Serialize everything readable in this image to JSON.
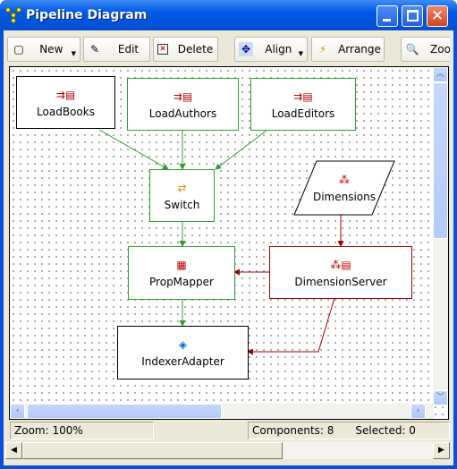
{
  "window": {
    "title": "Pipeline Diagram"
  },
  "toolbar": {
    "new": "New",
    "edit": "Edit",
    "delete": "Delete",
    "align": "Align",
    "arrange": "Arrange",
    "zoom": "Zoom"
  },
  "nodes": {
    "load_books": "LoadBooks",
    "load_authors": "LoadAuthors",
    "load_editors": "LoadEditors",
    "switch": "Switch",
    "dimensions": "Dimensions",
    "prop_mapper": "PropMapper",
    "dimension_server": "DimensionServer",
    "indexer_adapter": "IndexerAdapter"
  },
  "colors": {
    "green_edge": "#2ca02c",
    "red_edge": "#a00000",
    "green_border": "#2ca02c",
    "red_border": "#a00000"
  },
  "status": {
    "zoom": "Zoom: 100%",
    "components": "Components: 8",
    "selected": "Selected: 0"
  }
}
